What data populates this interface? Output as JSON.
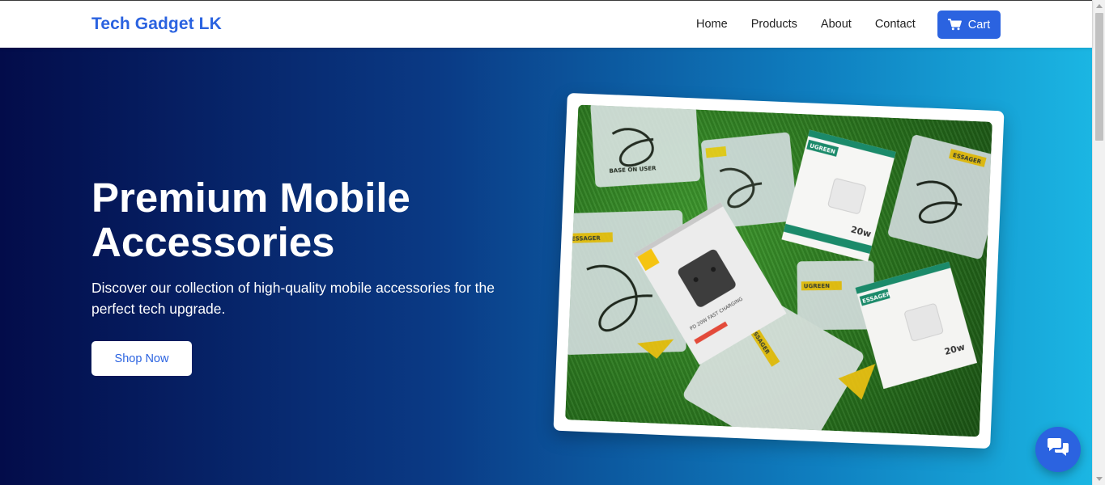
{
  "navbar": {
    "brand": "Tech Gadget LK",
    "links": [
      "Home",
      "Products",
      "About",
      "Contact"
    ],
    "cart_label": "Cart",
    "cart_icon": "shopping-cart-icon"
  },
  "hero": {
    "title": "Premium Mobile Accessories",
    "subtitle": "Discover our collection of high-quality mobile accessories for the perfect tech upgrade.",
    "cta_label": "Shop Now",
    "image": {
      "alt": "product-photo",
      "labels": [
        "BASE ON USER",
        "UGREEN",
        "ESSAGER",
        "PD 20W FAST CHARGING",
        "20w",
        "ESSAGER",
        "ESSAGER",
        "UGREEN",
        "20w",
        "ESSAGER"
      ]
    }
  },
  "chat": {
    "icon": "chat-bubbles-icon"
  },
  "colors": {
    "accent": "#2b63e0",
    "hero_gradient_start": "#030c4a",
    "hero_gradient_end": "#1bb6e3"
  }
}
